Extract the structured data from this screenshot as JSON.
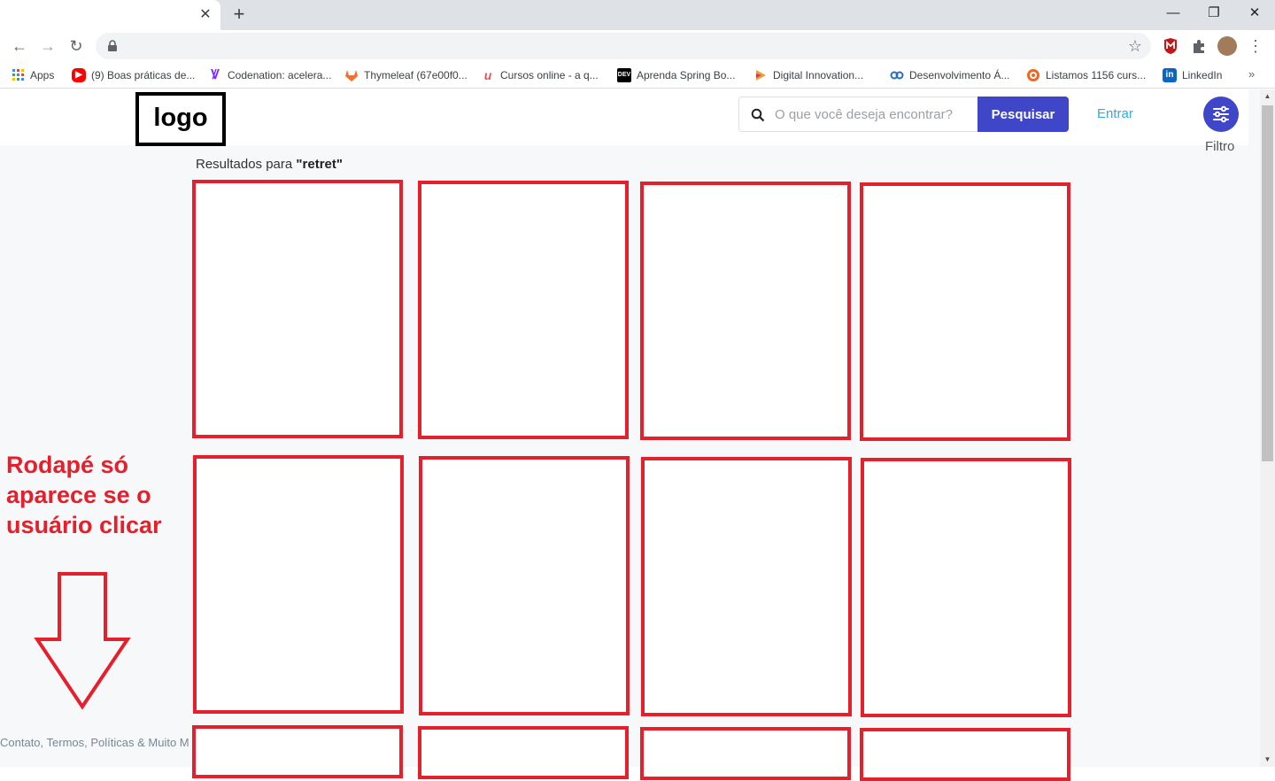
{
  "browser": {
    "new_tab_glyph": "+",
    "bookmarks": [
      {
        "label": "Apps",
        "icon": "apps-grid-icon",
        "color": "#4285f4"
      },
      {
        "label": "(9) Boas práticas de...",
        "icon": "youtube-icon",
        "color": "#ff0000"
      },
      {
        "label": "Codenation: acelera...",
        "icon": "codenation-icon",
        "color": "#7b2ff7"
      },
      {
        "label": "Thymeleaf (67e00f0...",
        "icon": "gitlab-icon",
        "color": "#fc6d26"
      },
      {
        "label": "Cursos online - a q...",
        "icon": "udemy-icon",
        "color": "#ec5252"
      },
      {
        "label": "Aprenda Spring Bo...",
        "icon": "dev-icon",
        "color": "#000000"
      },
      {
        "label": "Digital Innovation...",
        "icon": "dio-icon",
        "color": "#e9a13b"
      },
      {
        "label": "Desenvolvimento Á...",
        "icon": "link-icon",
        "color": "#2a6ebb"
      },
      {
        "label": "Listamos 1156 curs...",
        "icon": "target-icon",
        "color": "#f26522"
      },
      {
        "label": "LinkedIn",
        "icon": "linkedin-icon",
        "color": "#0a66c2"
      }
    ]
  },
  "site": {
    "logo": "logo",
    "search": {
      "placeholder": "O que você deseja encontrar?",
      "button": "Pesquisar"
    },
    "login": "Entrar",
    "filter": "Filtro",
    "results": {
      "prefix": "Resultados para ",
      "query": "\"retret\""
    },
    "annotation": "Rodapé só aparece se o usuário clicar",
    "footer": "Contato, Termos, Políticas & Muito Mais"
  },
  "colors": {
    "accent": "#3f46c8",
    "card_border": "#e3202b",
    "link": "#3aa8d8"
  }
}
